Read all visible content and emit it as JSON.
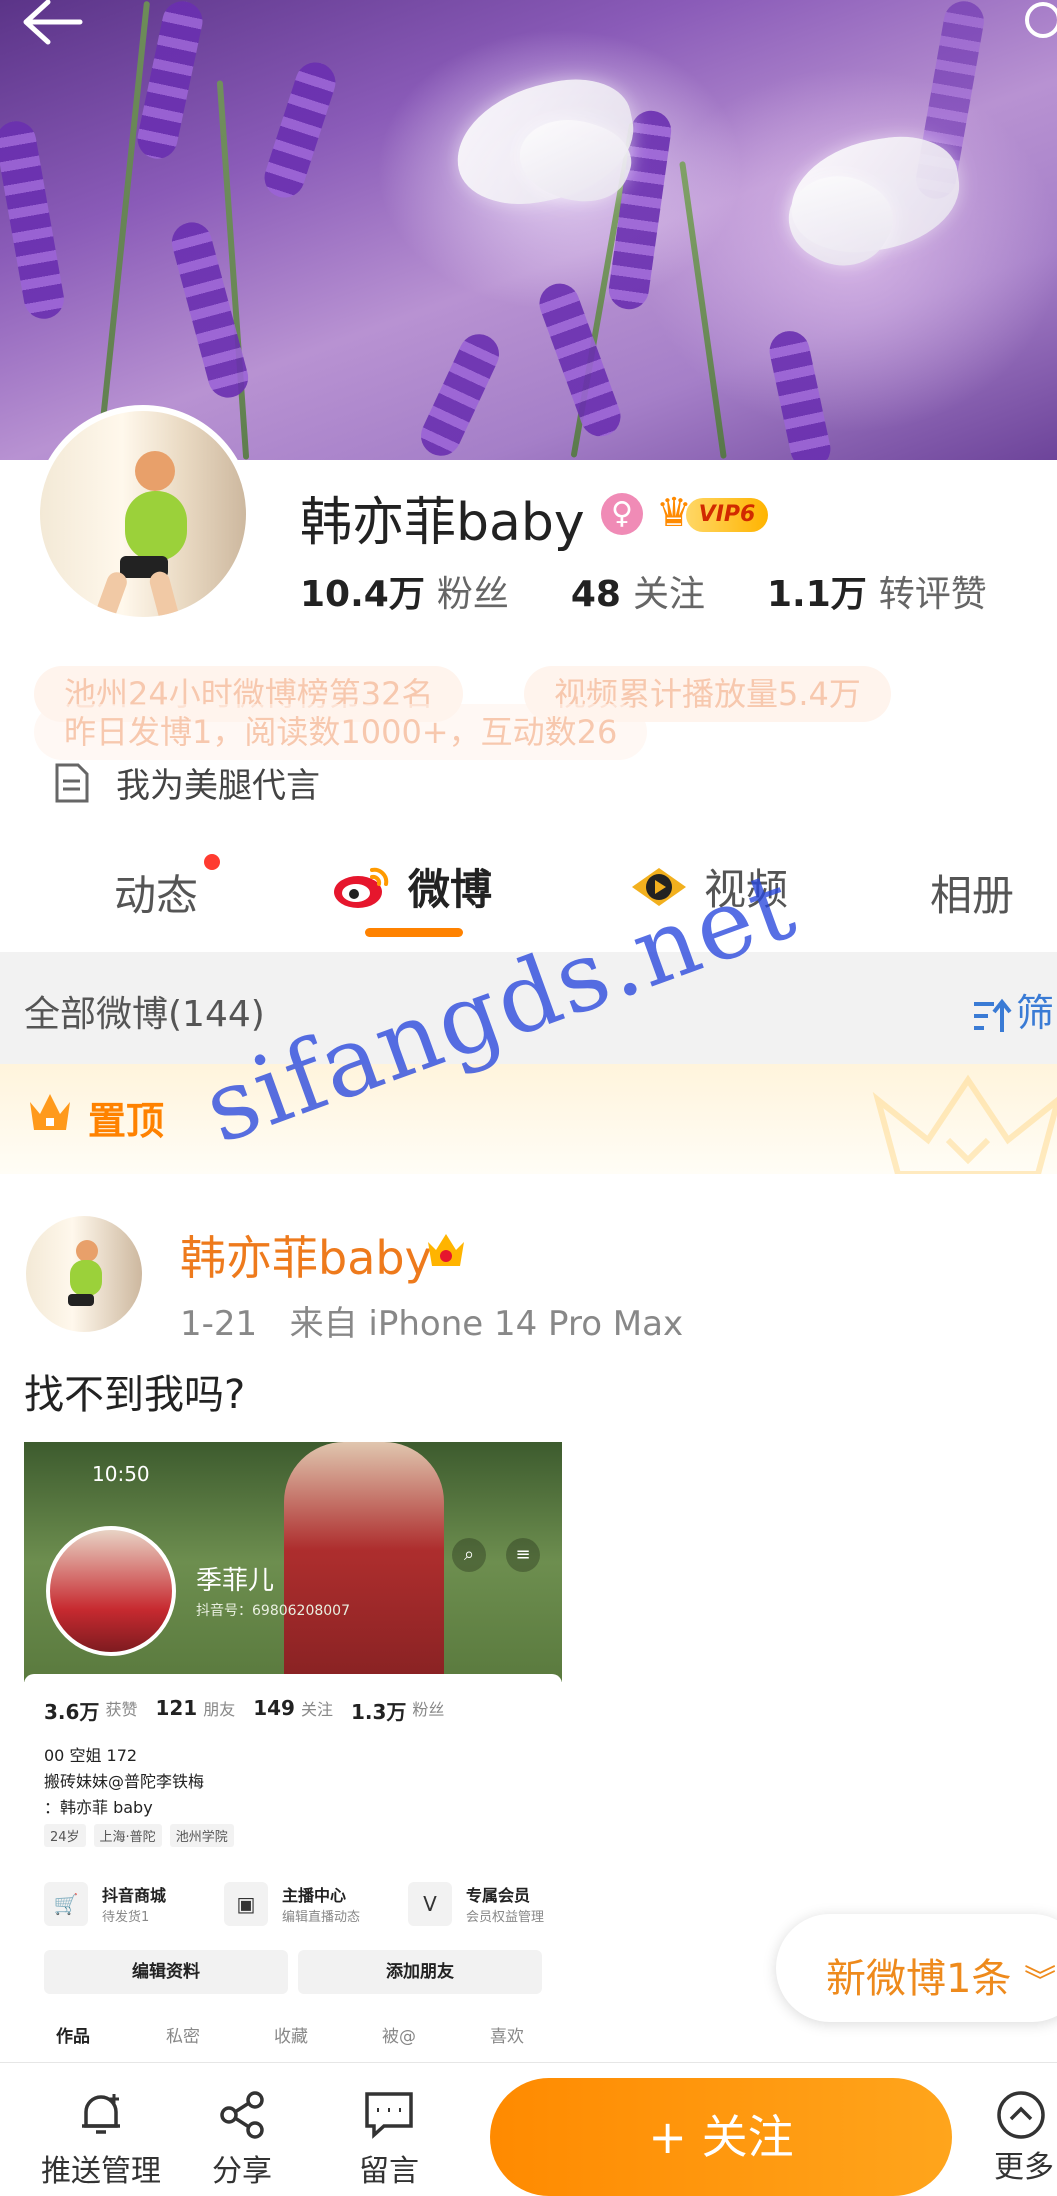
{
  "profile": {
    "name": "韩亦菲baby",
    "vip_label": "VIP6",
    "stats": [
      {
        "num": "10.4万",
        "label": "粉丝"
      },
      {
        "num": "48",
        "label": "关注"
      },
      {
        "num": "1.1万",
        "label": "转评赞"
      }
    ],
    "tags": [
      "池州24小时微博榜第32名",
      "视频累计播放量5.4万",
      "昨日发博1，阅读数1000+，互动数26"
    ],
    "description": "我为美腿代言"
  },
  "tabs": [
    {
      "label": "动态"
    },
    {
      "label": "微博"
    },
    {
      "label": "视频"
    },
    {
      "label": "相册"
    }
  ],
  "filter": {
    "title": "全部微博(144)",
    "button": "筛"
  },
  "pinned": {
    "label": "置顶"
  },
  "post": {
    "author": "韩亦菲baby",
    "date": "1-21",
    "source": "来自 iPhone 14 Pro Max",
    "text": "找不到我吗?"
  },
  "screenshot": {
    "time": "10:50",
    "name": "季菲儿",
    "id": "抖音号：69806208007",
    "stats": [
      {
        "num": "3.6万",
        "label": "获赞"
      },
      {
        "num": "121",
        "label": "朋友"
      },
      {
        "num": "149",
        "label": "关注"
      },
      {
        "num": "1.3万",
        "label": "粉丝"
      }
    ],
    "bio_lines": [
      "00 空姐 172",
      "搬砖妹妹@普陀李铁梅",
      "：韩亦菲 baby"
    ],
    "chips": [
      "24岁",
      "上海·普陀",
      "池州学院"
    ],
    "services": [
      {
        "title": "抖音商城",
        "sub": "待发货1"
      },
      {
        "title": "主播中心",
        "sub": "编辑直播动态"
      },
      {
        "title": "专属会员",
        "sub": "会员权益管理"
      }
    ],
    "buttons": [
      "编辑资料",
      "添加朋友"
    ],
    "tabs": [
      "作品",
      "私密",
      "收藏",
      "被@",
      "喜欢"
    ]
  },
  "watermark": "sifangds.net",
  "new_weibo": "新微博1条",
  "bottom": {
    "push": "推送管理",
    "share": "分享",
    "message": "留言",
    "follow": "+ 关注",
    "more": "更多"
  }
}
